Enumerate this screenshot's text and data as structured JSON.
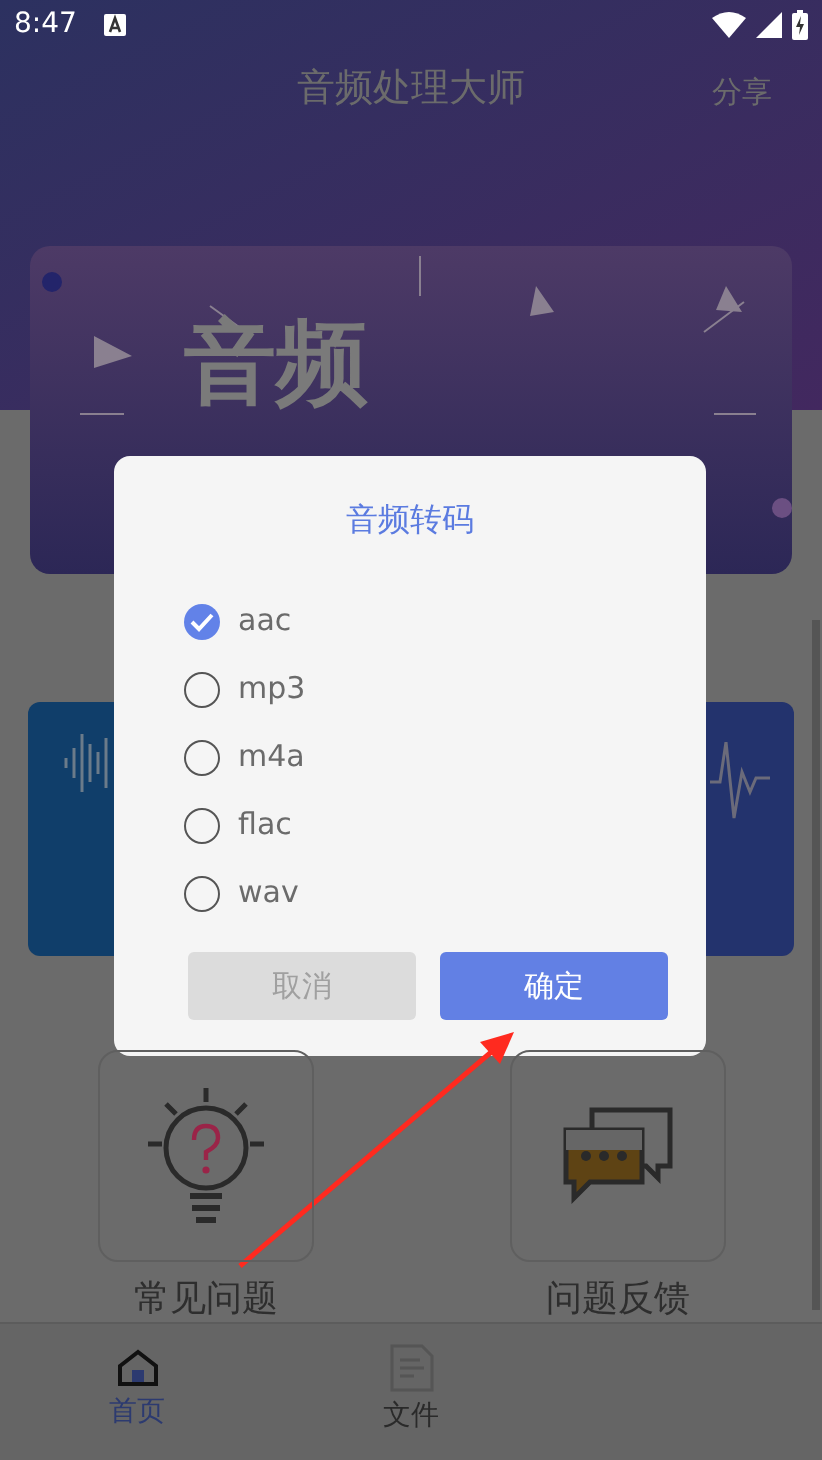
{
  "status_bar": {
    "time": "8:47"
  },
  "app_bar": {
    "title": "音频处理大师",
    "action": "分享"
  },
  "banner": {
    "headline": "音频"
  },
  "features": [
    {
      "label": "常见问题",
      "kind": "bulb"
    },
    {
      "label": "问题反馈",
      "kind": "chat"
    }
  ],
  "bottom_nav": [
    {
      "label": "首页",
      "kind": "home",
      "selected": true
    },
    {
      "label": "文件",
      "kind": "file",
      "selected": false
    }
  ],
  "dialog": {
    "title": "音频转码",
    "options": [
      {
        "label": "aac",
        "selected": true
      },
      {
        "label": "mp3",
        "selected": false
      },
      {
        "label": "m4a",
        "selected": false
      },
      {
        "label": "flac",
        "selected": false
      },
      {
        "label": "wav",
        "selected": false
      }
    ],
    "buttons": [
      {
        "label": "取消",
        "kind": "cancel"
      },
      {
        "label": "确定",
        "kind": "confirm"
      }
    ]
  }
}
